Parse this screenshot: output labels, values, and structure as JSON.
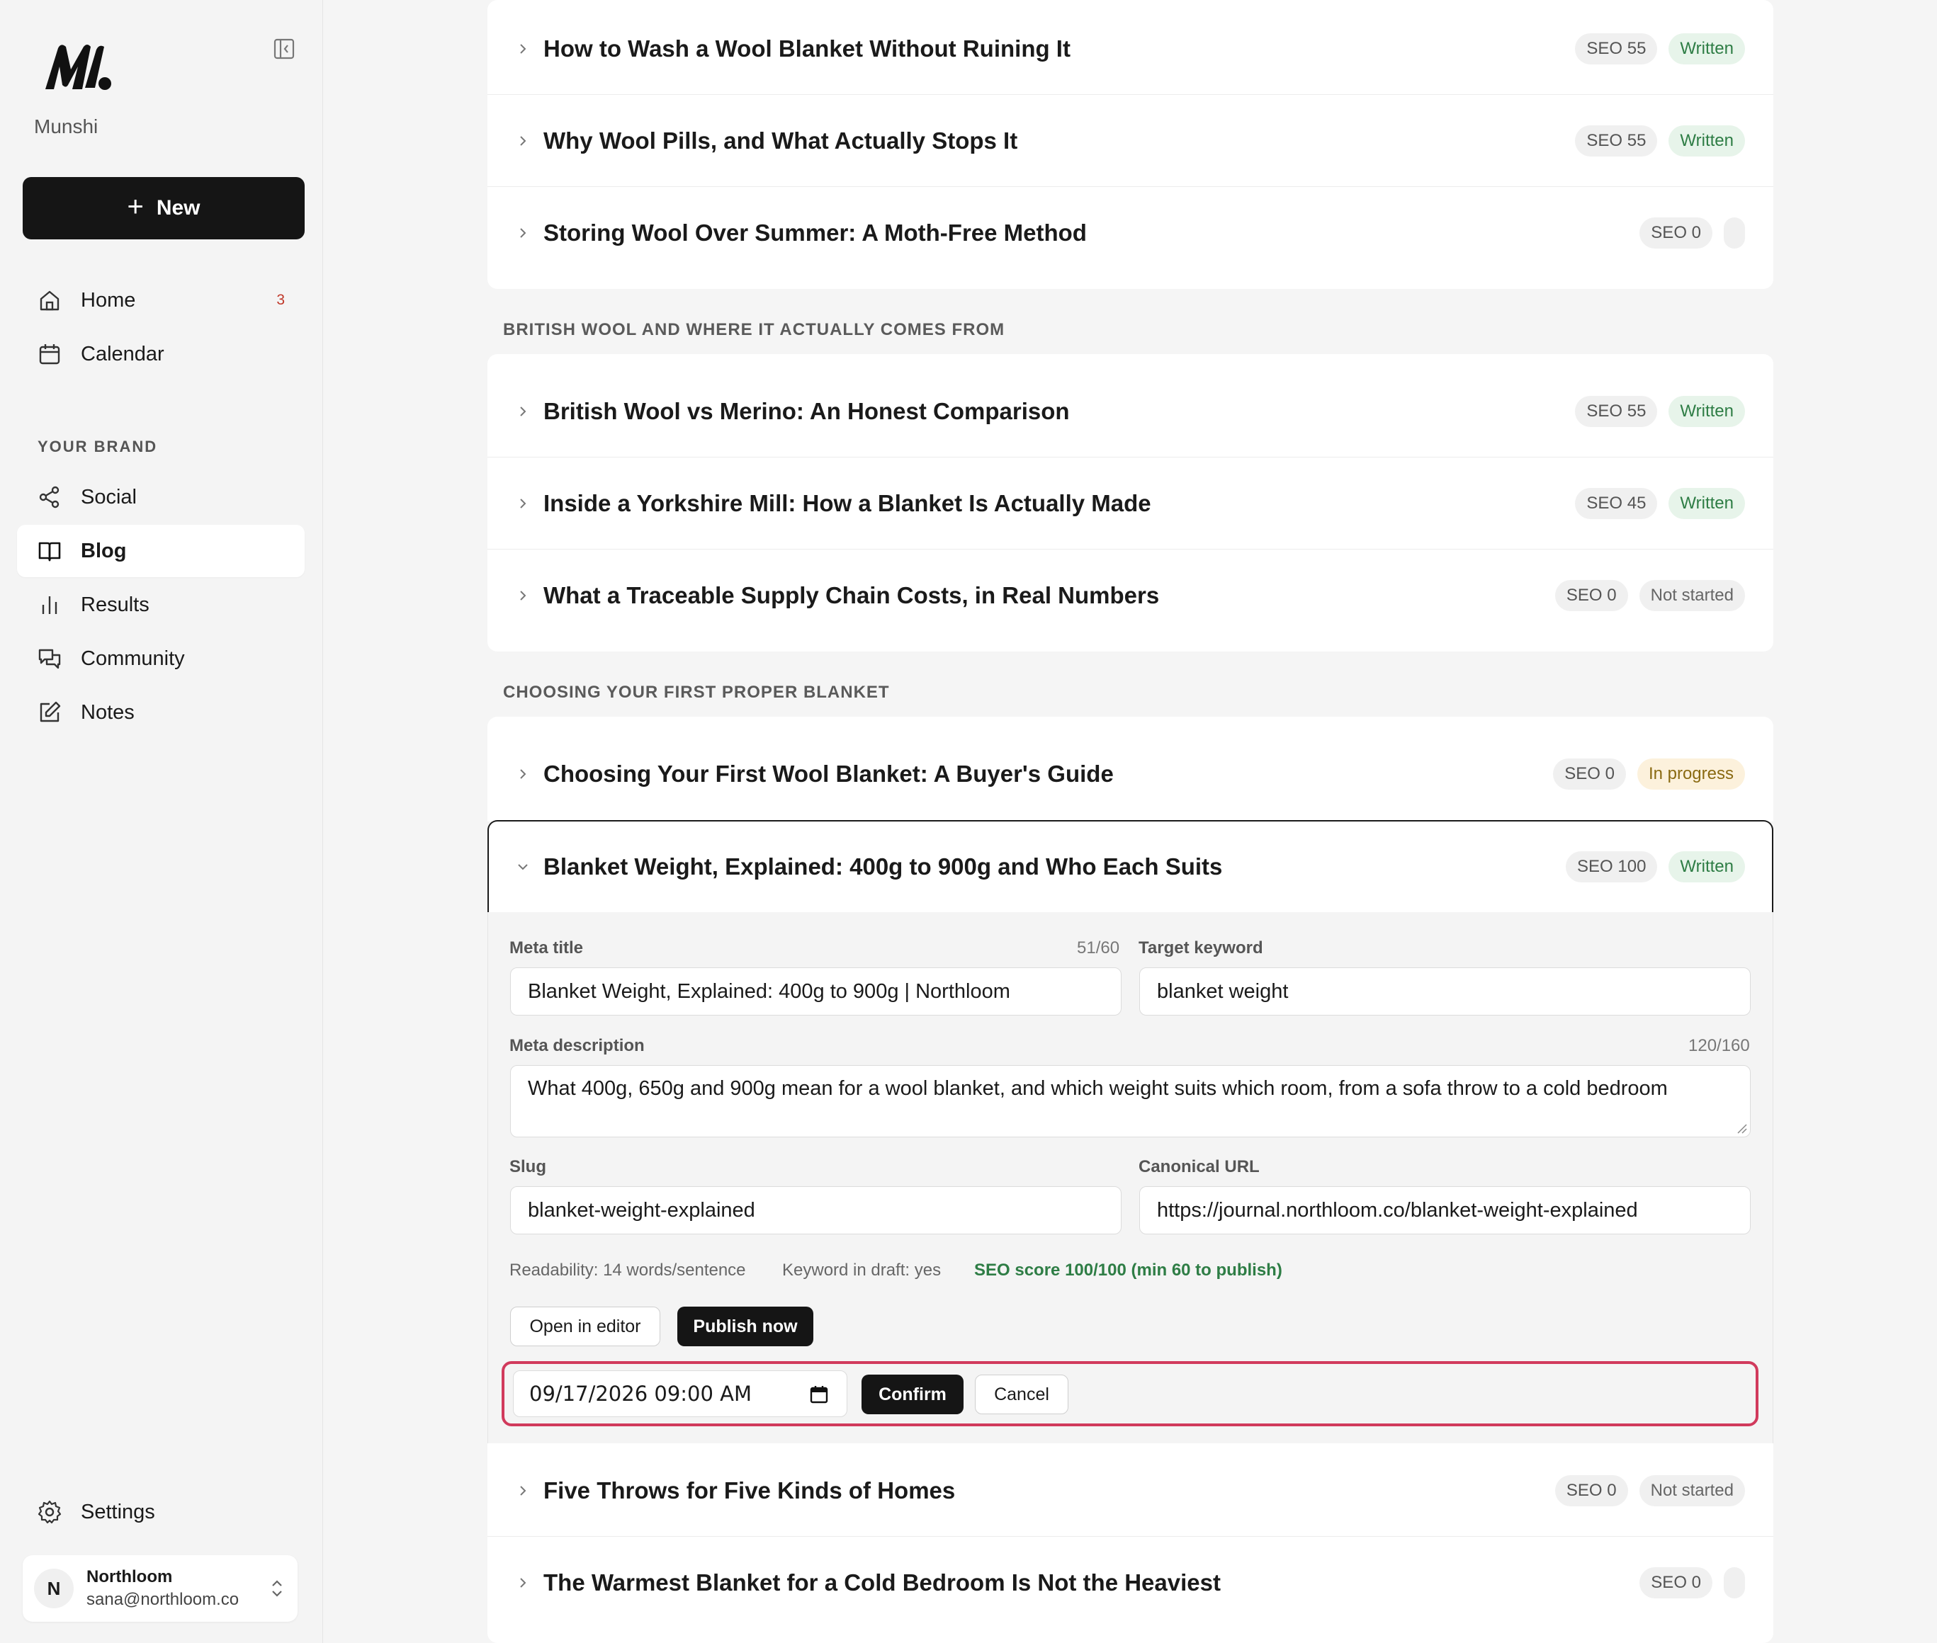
{
  "sidebar": {
    "brand": "Munshi",
    "new_label": "New",
    "nav": [
      {
        "label": "Home",
        "badge": "3"
      },
      {
        "label": "Calendar"
      }
    ],
    "section_label": "YOUR BRAND",
    "brand_nav": [
      {
        "label": "Social"
      },
      {
        "label": "Blog"
      },
      {
        "label": "Results"
      },
      {
        "label": "Community"
      },
      {
        "label": "Notes"
      }
    ],
    "settings_label": "Settings",
    "user": {
      "initial": "N",
      "name": "Northloom",
      "email": "sana@northloom.co"
    }
  },
  "groups": [
    {
      "label": "",
      "rows": [
        {
          "title": "How to Wash a Wool Blanket Without Ruining It",
          "seo": "SEO 55",
          "status": "Written"
        },
        {
          "title": "Why Wool Pills, and What Actually Stops It",
          "seo": "SEO 55",
          "status": "Written"
        },
        {
          "title": "Storing Wool Over Summer: A Moth-Free Method",
          "seo": "SEO 0",
          "status": ""
        }
      ]
    },
    {
      "label": "BRITISH WOOL AND WHERE IT ACTUALLY COMES FROM",
      "rows": [
        {
          "title": "British Wool vs Merino: An Honest Comparison",
          "seo": "SEO 55",
          "status": "Written"
        },
        {
          "title": "Inside a Yorkshire Mill: How a Blanket Is Actually Made",
          "seo": "SEO 45",
          "status": "Written"
        },
        {
          "title": "What a Traceable Supply Chain Costs, in Real Numbers",
          "seo": "SEO 0",
          "status": "Not started"
        }
      ]
    },
    {
      "label": "CHOOSING YOUR FIRST PROPER BLANKET",
      "rows": [
        {
          "title": "Choosing Your First Wool Blanket: A Buyer's Guide",
          "seo": "SEO 0",
          "status": "In progress"
        },
        {
          "title": "Blanket Weight, Explained: 400g to 900g and Who Each Suits",
          "seo": "SEO 100",
          "status": "Written"
        },
        {
          "title": "Five Throws for Five Kinds of Homes",
          "seo": "SEO 0",
          "status": "Not started"
        },
        {
          "title": "The Warmest Blanket for a Cold Bedroom Is Not the Heaviest",
          "seo": "SEO 0",
          "status": ""
        }
      ]
    }
  ],
  "expanded": {
    "meta_title_label": "Meta title",
    "meta_title_count": "51/60",
    "meta_title": "Blanket Weight, Explained: 400g to 900g | Northloom",
    "keyword_label": "Target keyword",
    "keyword": "blanket weight",
    "desc_label": "Meta description",
    "desc_count": "120/160",
    "desc": "What 400g, 650g and 900g mean for a wool blanket, and which weight suits which room, from a sofa throw to a cold bedroom",
    "slug_label": "Slug",
    "slug": "blanket-weight-explained",
    "canonical_label": "Canonical URL",
    "canonical": "https://journal.northloom.co/blanket-weight-explained",
    "readability": "Readability: 14 words/sentence",
    "keyword_in_draft": "Keyword in draft: yes",
    "seo_score": "SEO score 100/100 (min 60 to publish)",
    "open_editor": "Open in editor",
    "publish_now": "Publish now",
    "schedule_datetime": "09/17/2026 09:00 AM",
    "confirm": "Confirm",
    "cancel": "Cancel"
  }
}
